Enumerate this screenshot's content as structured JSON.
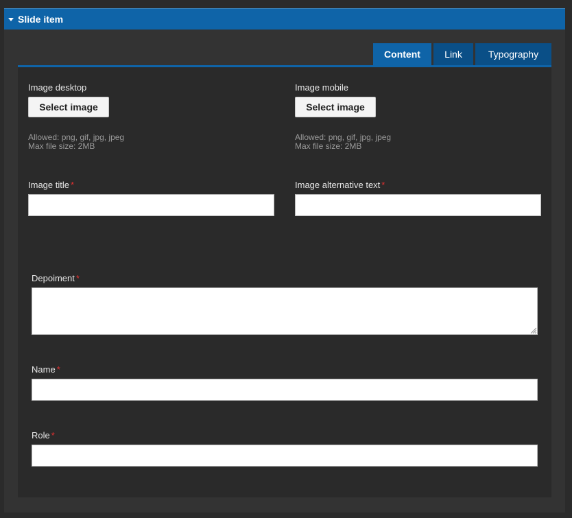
{
  "header": {
    "title": "Slide item"
  },
  "tabs": [
    {
      "label": "Content"
    },
    {
      "label": "Link"
    },
    {
      "label": "Typography"
    }
  ],
  "content": {
    "image_desktop": {
      "label": "Image desktop",
      "button": "Select image",
      "hint_allowed": "Allowed: png, gif, jpg, jpeg",
      "hint_size": "Max file size: 2MB"
    },
    "image_mobile": {
      "label": "Image mobile",
      "button": "Select image",
      "hint_allowed": "Allowed: png, gif, jpg, jpeg",
      "hint_size": "Max file size: 2MB"
    },
    "image_title": {
      "label": "Image title",
      "value": ""
    },
    "image_alt": {
      "label": "Image alternative text",
      "value": ""
    },
    "depoiment": {
      "label": "Depoiment",
      "value": ""
    },
    "name": {
      "label": "Name",
      "value": ""
    },
    "role": {
      "label": "Role",
      "value": ""
    },
    "required_mark": "*"
  },
  "colors": {
    "accent": "#0f64a8",
    "tab_inactive": "#0a4f87",
    "required": "#e03030"
  }
}
